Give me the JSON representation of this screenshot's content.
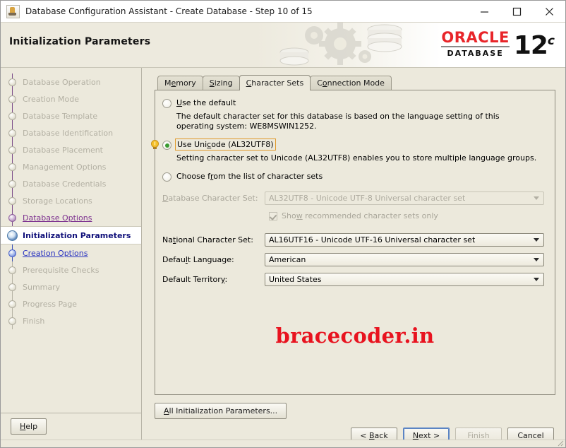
{
  "window": {
    "title": "Database Configuration Assistant - Create Database - Step 10 of 15",
    "app_icon": "java-coffee-cup-icon",
    "minimize_label": "—",
    "maximize_label": "□",
    "close_label": "✕"
  },
  "banner": {
    "page_title": "Initialization Parameters",
    "brand": "ORACLE",
    "brand_sub": "DATABASE",
    "version_number": "12",
    "version_suffix": "c",
    "brand_color": "#e8252a"
  },
  "sidebar": {
    "steps": [
      {
        "label": "Database Operation",
        "state": "done"
      },
      {
        "label": "Creation Mode",
        "state": "done"
      },
      {
        "label": "Database Template",
        "state": "done"
      },
      {
        "label": "Database Identification",
        "state": "done"
      },
      {
        "label": "Database Placement",
        "state": "done"
      },
      {
        "label": "Management Options",
        "state": "done"
      },
      {
        "label": "Database Credentials",
        "state": "done"
      },
      {
        "label": "Storage Locations",
        "state": "done"
      },
      {
        "label": "Database Options",
        "state": "visited-link"
      },
      {
        "label": "Initialization Parameters",
        "state": "current"
      },
      {
        "label": "Creation Options",
        "state": "link"
      },
      {
        "label": "Prerequisite Checks",
        "state": "pending"
      },
      {
        "label": "Summary",
        "state": "pending"
      },
      {
        "label": "Progress Page",
        "state": "pending"
      },
      {
        "label": "Finish",
        "state": "pending"
      }
    ],
    "help_button": "Help"
  },
  "tabs": [
    {
      "label": "Memory",
      "active": false
    },
    {
      "label": "Sizing",
      "active": false
    },
    {
      "label": "Character Sets",
      "active": true
    },
    {
      "label": "Connection Mode",
      "active": false
    }
  ],
  "character_sets": {
    "option_default": {
      "label": "Use the default",
      "selected": false,
      "description": "The default character set for this database is based on the language setting of this operating system: WE8MSWIN1252."
    },
    "option_unicode": {
      "label": "Use Unicode (AL32UTF8)",
      "selected": true,
      "focused": true,
      "tip_icon": "lightbulb-icon",
      "description": "Setting character set to Unicode (AL32UTF8) enables you to store multiple language groups."
    },
    "option_choose": {
      "label": "Choose from the list of character sets",
      "selected": false
    },
    "database_character_set": {
      "label": "Database Character Set:",
      "value": "AL32UTF8 - Unicode UTF-8 Universal character set",
      "enabled": false
    },
    "show_recommended": {
      "label": "Show recommended character sets only",
      "checked": true,
      "enabled": false
    },
    "national_character_set": {
      "label": "National Character Set:",
      "value": "AL16UTF16 - Unicode UTF-16 Universal character set",
      "enabled": true
    },
    "default_language": {
      "label": "Default Language:",
      "value": "American",
      "enabled": true
    },
    "default_territory": {
      "label": "Default Territory:",
      "value": "United States",
      "enabled": true
    }
  },
  "watermark": {
    "text": "bracecoder.in",
    "color": "#e8131f"
  },
  "footer": {
    "all_init_params": "All Initialization Parameters...",
    "back": "< Back",
    "next": "Next >",
    "finish": "Finish",
    "cancel": "Cancel"
  }
}
